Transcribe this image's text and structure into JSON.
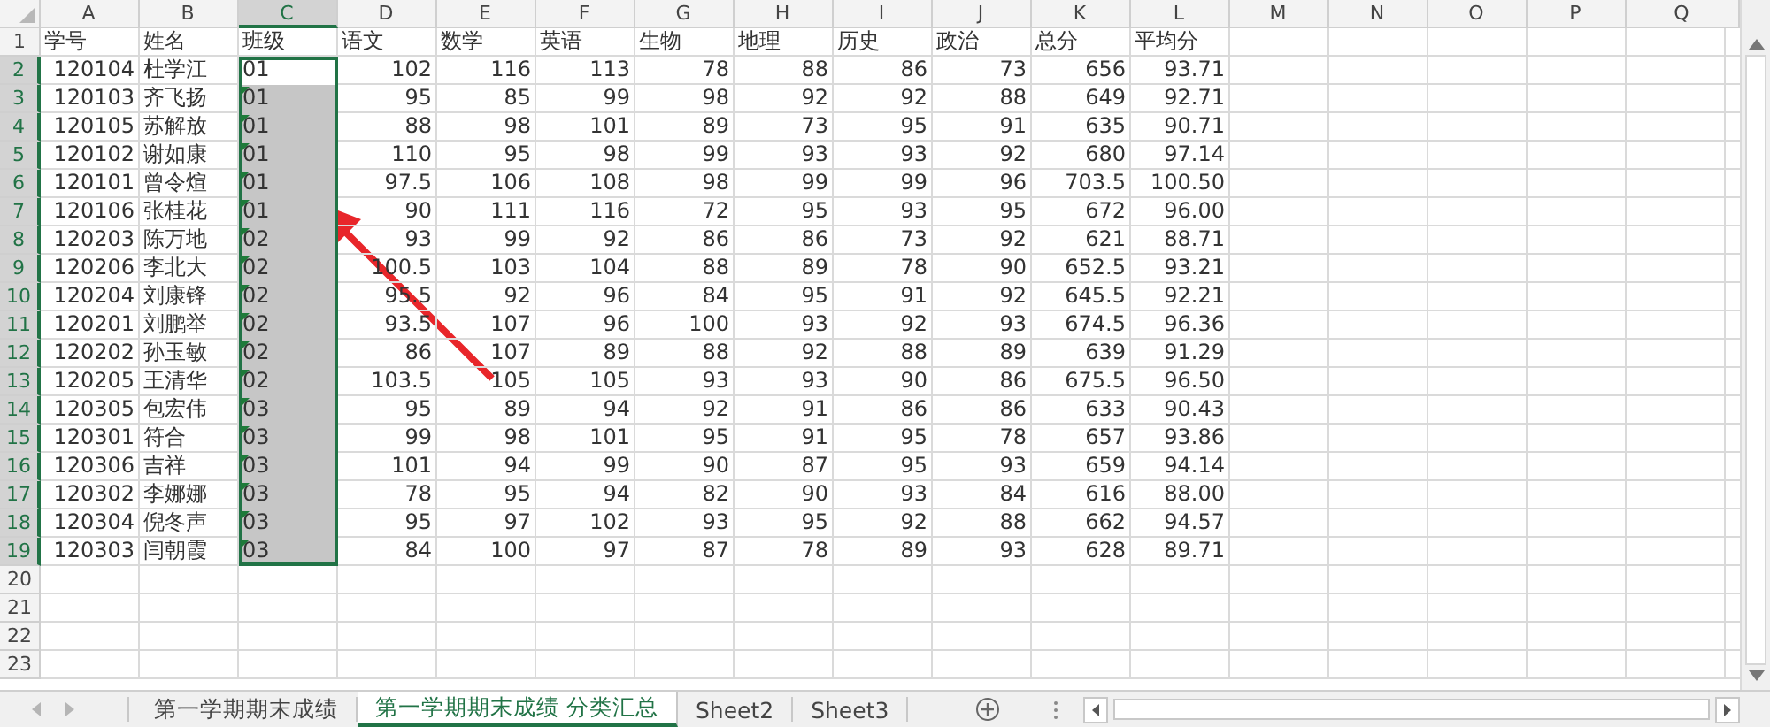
{
  "grid": {
    "columns": [
      {
        "label": "A",
        "kind": "number",
        "selected": false
      },
      {
        "label": "B",
        "kind": "text",
        "selected": false
      },
      {
        "label": "C",
        "kind": "text",
        "selected": true
      },
      {
        "label": "D",
        "kind": "number",
        "selected": false
      },
      {
        "label": "E",
        "kind": "number",
        "selected": false
      },
      {
        "label": "F",
        "kind": "number",
        "selected": false
      },
      {
        "label": "G",
        "kind": "number",
        "selected": false
      },
      {
        "label": "H",
        "kind": "number",
        "selected": false
      },
      {
        "label": "I",
        "kind": "number",
        "selected": false
      },
      {
        "label": "J",
        "kind": "number",
        "selected": false
      },
      {
        "label": "K",
        "kind": "number",
        "selected": false
      },
      {
        "label": "L",
        "kind": "number",
        "selected": false
      },
      {
        "label": "M",
        "kind": "empty",
        "selected": false
      },
      {
        "label": "N",
        "kind": "empty",
        "selected": false
      },
      {
        "label": "O",
        "kind": "empty",
        "selected": false
      },
      {
        "label": "P",
        "kind": "empty",
        "selected": false
      },
      {
        "label": "Q",
        "kind": "empty",
        "selected": false
      }
    ],
    "rows": [
      {
        "label": "1",
        "kind": "header",
        "selected": false,
        "cells": [
          "学号",
          "姓名",
          "班级",
          "语文",
          "数学",
          "英语",
          "生物",
          "地理",
          "历史",
          "政治",
          "总分",
          "平均分"
        ]
      },
      {
        "label": "2",
        "kind": "data",
        "selected": true,
        "active": true,
        "flag": false,
        "cells": [
          "120104",
          "杜学江",
          "01",
          "102",
          "116",
          "113",
          "78",
          "88",
          "86",
          "73",
          "656",
          "93.71"
        ]
      },
      {
        "label": "3",
        "kind": "data",
        "selected": true,
        "active": false,
        "flag": true,
        "cells": [
          "120103",
          "齐飞扬",
          "01",
          "95",
          "85",
          "99",
          "98",
          "92",
          "92",
          "88",
          "649",
          "92.71"
        ]
      },
      {
        "label": "4",
        "kind": "data",
        "selected": true,
        "active": false,
        "flag": true,
        "cells": [
          "120105",
          "苏解放",
          "01",
          "88",
          "98",
          "101",
          "89",
          "73",
          "95",
          "91",
          "635",
          "90.71"
        ]
      },
      {
        "label": "5",
        "kind": "data",
        "selected": true,
        "active": false,
        "flag": true,
        "cells": [
          "120102",
          "谢如康",
          "01",
          "110",
          "95",
          "98",
          "99",
          "93",
          "93",
          "92",
          "680",
          "97.14"
        ]
      },
      {
        "label": "6",
        "kind": "data",
        "selected": true,
        "active": false,
        "flag": true,
        "cells": [
          "120101",
          "曾令煊",
          "01",
          "97.5",
          "106",
          "108",
          "98",
          "99",
          "99",
          "96",
          "703.5",
          "100.50"
        ]
      },
      {
        "label": "7",
        "kind": "data",
        "selected": true,
        "active": false,
        "flag": true,
        "cells": [
          "120106",
          "张桂花",
          "01",
          "90",
          "111",
          "116",
          "72",
          "95",
          "93",
          "95",
          "672",
          "96.00"
        ]
      },
      {
        "label": "8",
        "kind": "data",
        "selected": true,
        "active": false,
        "flag": true,
        "cells": [
          "120203",
          "陈万地",
          "02",
          "93",
          "99",
          "92",
          "86",
          "86",
          "73",
          "92",
          "621",
          "88.71"
        ]
      },
      {
        "label": "9",
        "kind": "data",
        "selected": true,
        "active": false,
        "flag": true,
        "cells": [
          "120206",
          "李北大",
          "02",
          "100.5",
          "103",
          "104",
          "88",
          "89",
          "78",
          "90",
          "652.5",
          "93.21"
        ]
      },
      {
        "label": "10",
        "kind": "data",
        "selected": true,
        "active": false,
        "flag": true,
        "cells": [
          "120204",
          "刘康锋",
          "02",
          "95.5",
          "92",
          "96",
          "84",
          "95",
          "91",
          "92",
          "645.5",
          "92.21"
        ]
      },
      {
        "label": "11",
        "kind": "data",
        "selected": true,
        "active": false,
        "flag": true,
        "cells": [
          "120201",
          "刘鹏举",
          "02",
          "93.5",
          "107",
          "96",
          "100",
          "93",
          "92",
          "93",
          "674.5",
          "96.36"
        ]
      },
      {
        "label": "12",
        "kind": "data",
        "selected": true,
        "active": false,
        "flag": true,
        "cells": [
          "120202",
          "孙玉敏",
          "02",
          "86",
          "107",
          "89",
          "88",
          "92",
          "88",
          "89",
          "639",
          "91.29"
        ]
      },
      {
        "label": "13",
        "kind": "data",
        "selected": true,
        "active": false,
        "flag": true,
        "cells": [
          "120205",
          "王清华",
          "02",
          "103.5",
          "105",
          "105",
          "93",
          "93",
          "90",
          "86",
          "675.5",
          "96.50"
        ]
      },
      {
        "label": "14",
        "kind": "data",
        "selected": true,
        "active": false,
        "flag": true,
        "cells": [
          "120305",
          "包宏伟",
          "03",
          "95",
          "89",
          "94",
          "92",
          "91",
          "86",
          "86",
          "633",
          "90.43"
        ]
      },
      {
        "label": "15",
        "kind": "data",
        "selected": true,
        "active": false,
        "flag": true,
        "cells": [
          "120301",
          "符合",
          "03",
          "99",
          "98",
          "101",
          "95",
          "91",
          "95",
          "78",
          "657",
          "93.86"
        ]
      },
      {
        "label": "16",
        "kind": "data",
        "selected": true,
        "active": false,
        "flag": true,
        "cells": [
          "120306",
          "吉祥",
          "03",
          "101",
          "94",
          "99",
          "90",
          "87",
          "95",
          "93",
          "659",
          "94.14"
        ]
      },
      {
        "label": "17",
        "kind": "data",
        "selected": true,
        "active": false,
        "flag": true,
        "cells": [
          "120302",
          "李娜娜",
          "03",
          "78",
          "95",
          "94",
          "82",
          "90",
          "93",
          "84",
          "616",
          "88.00"
        ]
      },
      {
        "label": "18",
        "kind": "data",
        "selected": true,
        "active": false,
        "flag": true,
        "cells": [
          "120304",
          "倪冬声",
          "03",
          "95",
          "97",
          "102",
          "93",
          "95",
          "92",
          "88",
          "662",
          "94.57"
        ]
      },
      {
        "label": "19",
        "kind": "data",
        "selected": true,
        "active": false,
        "flag": true,
        "cells": [
          "120303",
          "闫朝霞",
          "03",
          "84",
          "100",
          "97",
          "87",
          "78",
          "89",
          "93",
          "628",
          "89.71"
        ]
      },
      {
        "label": "20",
        "kind": "empty",
        "selected": false
      },
      {
        "label": "21",
        "kind": "empty",
        "selected": false
      },
      {
        "label": "22",
        "kind": "empty",
        "selected": false
      },
      {
        "label": "23",
        "kind": "empty",
        "selected": false
      }
    ]
  },
  "sheet_tabs": [
    {
      "label": "第一学期期末成绩",
      "selected": false
    },
    {
      "label": "第一学期期末成绩 分类汇总",
      "selected": true
    },
    {
      "label": "Sheet2",
      "selected": false
    },
    {
      "label": "Sheet3",
      "selected": false
    }
  ]
}
